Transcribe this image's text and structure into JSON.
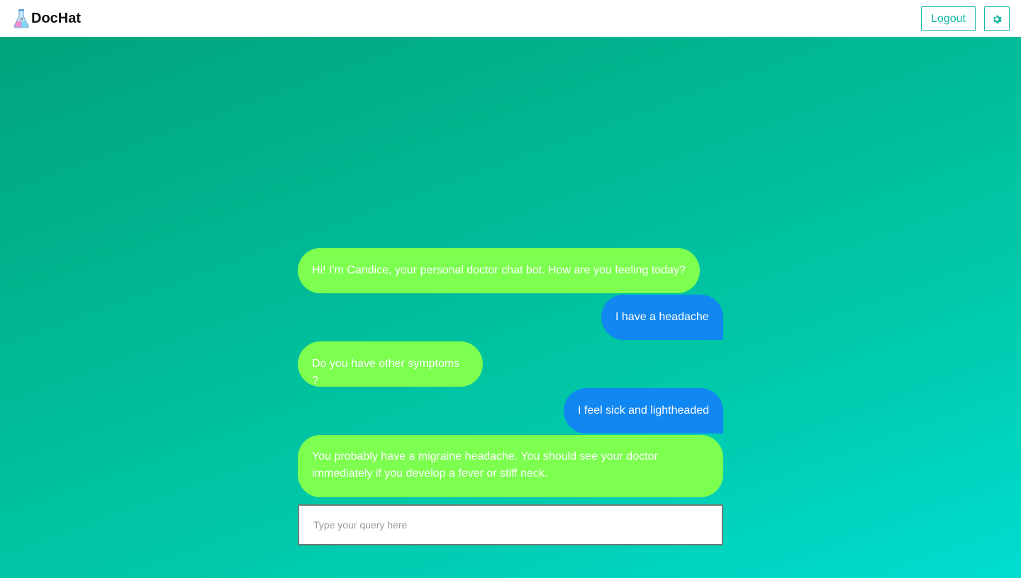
{
  "app": {
    "brand_name": "DocHat",
    "brand_icon": "flask-icon"
  },
  "header": {
    "logout_label": "Logout",
    "settings_icon": "gear-icon"
  },
  "colors": {
    "accent": "#14b8a6",
    "bot_bubble": "#7cff4f",
    "user_bubble": "#1187f2"
  },
  "chat": {
    "messages": [
      {
        "sender": "bot",
        "text": "Hi! I'm Candice, your personal doctor chat bot. How are you feeling today?"
      },
      {
        "sender": "user",
        "text": "I have a headache"
      },
      {
        "sender": "bot",
        "text": "Do you have other symptoms ?"
      },
      {
        "sender": "user",
        "text": "I feel sick and lightheaded"
      },
      {
        "sender": "bot",
        "text": "You probably have a migraine headache. You should see your doctor immediately if you develop a fever or stiff neck."
      }
    ]
  },
  "input": {
    "placeholder": "Type your query here",
    "value": ""
  }
}
